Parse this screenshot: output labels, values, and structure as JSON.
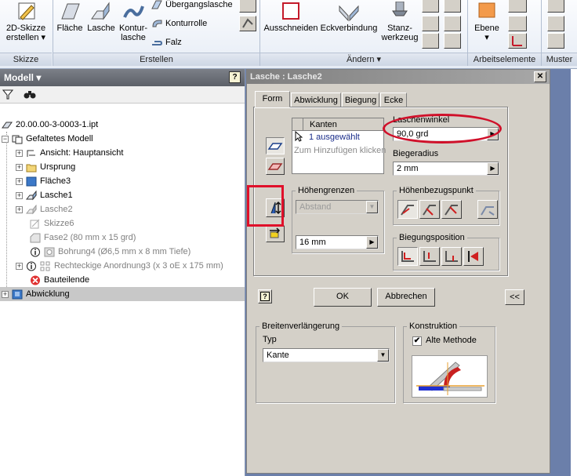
{
  "ribbon": {
    "groups": {
      "skizze": "Skizze",
      "erstellen": "Erstellen",
      "aendern": "Ändern",
      "arbeitselemente": "Arbeitselemente",
      "muster": "Muster"
    },
    "buttons": {
      "skizze_2d_line1": "2D-Skizze",
      "skizze_2d_line2": "erstellen",
      "flaeche": "Fläche",
      "lasche": "Lasche",
      "kontur_line1": "Kontur-",
      "kontur_line2": "lasche",
      "uebergangslasche": "Übergangslasche",
      "konturrolle": "Konturrolle",
      "falz": "Falz",
      "ausschneiden": "Ausschneiden",
      "eckverbindung": "Eckverbindung",
      "stanz_line1": "Stanz-",
      "stanz_line2": "werkzeug",
      "ebene": "Ebene"
    }
  },
  "browser": {
    "title": "Modell",
    "items": [
      {
        "label": "20.00.00-3-0003-1.ipt"
      },
      {
        "label": "Gefaltetes Modell"
      },
      {
        "label": "Ansicht: Hauptansicht"
      },
      {
        "label": "Ursprung"
      },
      {
        "label": "Fläche3"
      },
      {
        "label": "Lasche1"
      },
      {
        "label": "Lasche2"
      },
      {
        "label": "Skizze6"
      },
      {
        "label": "Fase2 (80 mm x 15 grd)"
      },
      {
        "label": "Bohrung4 (Ø6,5 mm x 8 mm Tiefe)"
      },
      {
        "label": "Rechteckige Anordnung3 (x 3 oE x 175 mm)"
      },
      {
        "label": "Bauteilende"
      },
      {
        "label": "Abwicklung"
      }
    ]
  },
  "dialog": {
    "title": "Lasche : Lasche2",
    "tabs": [
      "Form",
      "Abwicklung",
      "Biegung",
      "Ecke"
    ],
    "kanten_header": "Kanten",
    "kanten_selected": "1 ausgewählt",
    "kanten_hint": "Zum Hinzufügen klicken",
    "laschenwinkel_label": "Laschenwinkel",
    "laschenwinkel_value": "90,0 grd",
    "biegeradius_label": "Biegeradius",
    "biegeradius_value": "2 mm",
    "hoehengrenzen_label": "Höhengrenzen",
    "abstand_value": "Abstand",
    "hoehe_value": "16 mm",
    "hoehenbezugspunkt_label": "Höhenbezugspunkt",
    "biegungsposition_label": "Biegungsposition",
    "help_label": "?",
    "ok_label": "OK",
    "abbrechen_label": "Abbrechen",
    "collapse_label": "<<",
    "breitenverlaengerung_label": "Breitenverlängerung",
    "typ_label": "Typ",
    "typ_value": "Kante",
    "konstruktion_label": "Konstruktion",
    "alte_methode_label": "Alte Methode",
    "alte_methode_checked": true
  },
  "colors": {
    "highlight_red": "#e0102a",
    "workspace_blue": "#6b7faa",
    "dialog_gray": "#d4d0c8"
  }
}
